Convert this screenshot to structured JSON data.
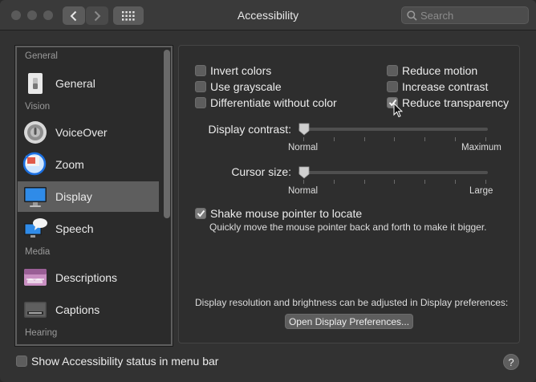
{
  "window": {
    "title": "Accessibility",
    "search_placeholder": "Search"
  },
  "sidebar": {
    "sections": [
      {
        "header": "General",
        "items": [
          {
            "label": "General",
            "icon": "general-switch-icon"
          }
        ]
      },
      {
        "header": "Vision",
        "items": [
          {
            "label": "VoiceOver",
            "icon": "voiceover-icon"
          },
          {
            "label": "Zoom",
            "icon": "zoom-icon"
          },
          {
            "label": "Display",
            "icon": "display-icon",
            "selected": true
          },
          {
            "label": "Speech",
            "icon": "speech-icon"
          }
        ]
      },
      {
        "header": "Media",
        "items": [
          {
            "label": "Descriptions",
            "icon": "descriptions-icon"
          },
          {
            "label": "Captions",
            "icon": "captions-icon"
          }
        ]
      },
      {
        "header": "Hearing",
        "items": []
      }
    ]
  },
  "options": {
    "invert_colors": {
      "label": "Invert colors",
      "checked": false
    },
    "use_grayscale": {
      "label": "Use grayscale",
      "checked": false
    },
    "differentiate": {
      "label": "Differentiate without color",
      "checked": false
    },
    "reduce_motion": {
      "label": "Reduce motion",
      "checked": false
    },
    "increase_contrast": {
      "label": "Increase contrast",
      "checked": false
    },
    "reduce_transparency": {
      "label": "Reduce transparency",
      "checked": true
    }
  },
  "display_contrast": {
    "label": "Display contrast:",
    "min_label": "Normal",
    "max_label": "Maximum",
    "value": 0
  },
  "cursor_size": {
    "label": "Cursor size:",
    "min_label": "Normal",
    "max_label": "Large",
    "value": 0
  },
  "shake": {
    "label": "Shake mouse pointer to locate",
    "checked": true,
    "description": "Quickly move the mouse pointer back and forth to make it bigger."
  },
  "display_prefs": {
    "note": "Display resolution and brightness can be adjusted in Display preferences:",
    "button": "Open Display Preferences..."
  },
  "footer": {
    "status_label": "Show Accessibility status in menu bar",
    "status_checked": false,
    "help": "?"
  }
}
